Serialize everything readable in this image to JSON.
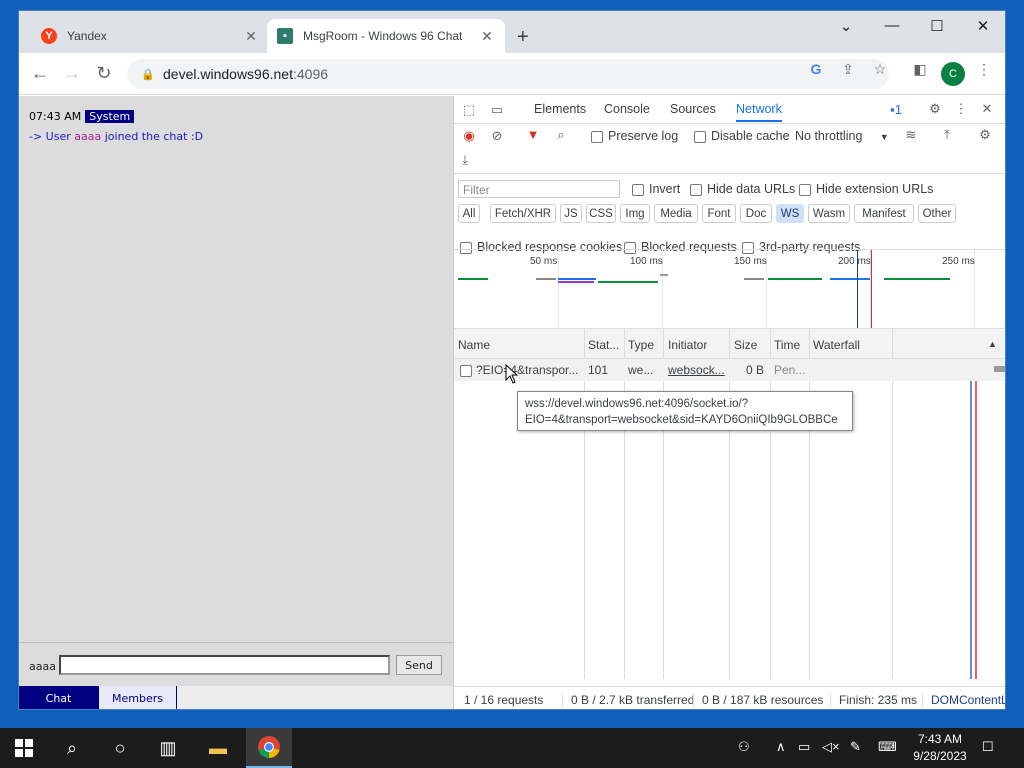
{
  "browser": {
    "tabs": [
      {
        "title": "Yandex",
        "favicon": "yandex-icon",
        "active": false
      },
      {
        "title": "MsgRoom - Windows 96 Chat",
        "favicon": "msgroom-icon",
        "active": true
      }
    ],
    "address": {
      "host": "devel.windows96.net",
      "port": ":4096"
    },
    "profile_initial": "C"
  },
  "chat": {
    "message": {
      "time": "07:43 AM",
      "sender": "System",
      "prefix": "-> User ",
      "username": "aaaa",
      "suffix": " joined the chat :D"
    },
    "composer": {
      "nickname": "aaaa",
      "input_value": "",
      "send_label": "Send"
    },
    "tabs": {
      "chat": "Chat",
      "members": "Members"
    }
  },
  "devtools": {
    "tabs": [
      "Elements",
      "Console",
      "Sources",
      "Network"
    ],
    "selected_tab": "Network",
    "issues_count": "1",
    "options": {
      "preserve_log": "Preserve log",
      "disable_cache": "Disable cache",
      "throttling": "No throttling"
    },
    "filter": {
      "placeholder": "Filter",
      "invert": "Invert",
      "hide_data_urls": "Hide data URLs",
      "hide_ext_urls": "Hide extension URLs"
    },
    "type_filters": [
      "All",
      "Fetch/XHR",
      "JS",
      "CSS",
      "Img",
      "Media",
      "Font",
      "Doc",
      "WS",
      "Wasm",
      "Manifest",
      "Other"
    ],
    "selected_type": "WS",
    "extra_filters": {
      "blocked_cookies": "Blocked response cookies",
      "blocked_requests": "Blocked requests",
      "third_party": "3rd-party requests"
    },
    "timeline_ticks": [
      "50 ms",
      "100 ms",
      "150 ms",
      "200 ms",
      "250 ms"
    ],
    "columns": [
      "Name",
      "Stat...",
      "Type",
      "Initiator",
      "Size",
      "Time",
      "Waterfall"
    ],
    "rows": [
      {
        "name": "?EIO=4&transpor...",
        "status": "101",
        "type": "we...",
        "initiator": "websock...",
        "size": "0 B",
        "time": "Pen..."
      }
    ],
    "tooltip": {
      "line1": "wss://devel.windows96.net:4096/socket.io/?",
      "line2": "EIO=4&transport=websocket&sid=KAYD6OniiQIb9GLOBBCe"
    },
    "status": {
      "requests": "1 / 16 requests",
      "transferred": "0 B / 2.7 kB transferred",
      "resources": "0 B / 187 kB resources",
      "finish": "Finish: 235 ms",
      "dcl": "DOMContentL"
    }
  },
  "taskbar": {
    "time": "7:43 AM",
    "date": "9/28/2023"
  },
  "colors": {
    "accent": "#1a73e8",
    "chat_navy": "#000080",
    "desktop": "#0f5fb8"
  }
}
